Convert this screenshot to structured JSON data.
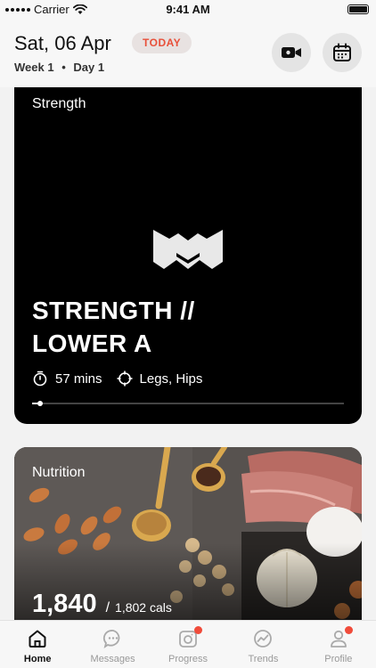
{
  "status_bar": {
    "carrier": "Carrier",
    "time": "9:41 AM"
  },
  "header": {
    "date": "Sat, 06 Apr",
    "badge": "TODAY",
    "week": "Week 1",
    "separator": "•",
    "day": "Day 1",
    "accent_color": "#e8503a"
  },
  "strength_card": {
    "category": "Strength",
    "title_line1": "STRENGTH //",
    "title_line2": "LOWER A",
    "duration": "57 mins",
    "focus": "Legs, Hips",
    "progress": 0.02
  },
  "nutrition_card": {
    "category": "Nutrition",
    "calories": "1,840",
    "separator": "/",
    "target": "1,802 cals"
  },
  "tabs": [
    {
      "label": "Home",
      "icon": "home-icon",
      "active": true,
      "badge": false
    },
    {
      "label": "Messages",
      "icon": "chat-icon",
      "active": false,
      "badge": false
    },
    {
      "label": "Progress",
      "icon": "camera-icon",
      "active": false,
      "badge": true
    },
    {
      "label": "Trends",
      "icon": "trends-icon",
      "active": false,
      "badge": false
    },
    {
      "label": "Profile",
      "icon": "profile-icon",
      "active": false,
      "badge": true
    }
  ]
}
